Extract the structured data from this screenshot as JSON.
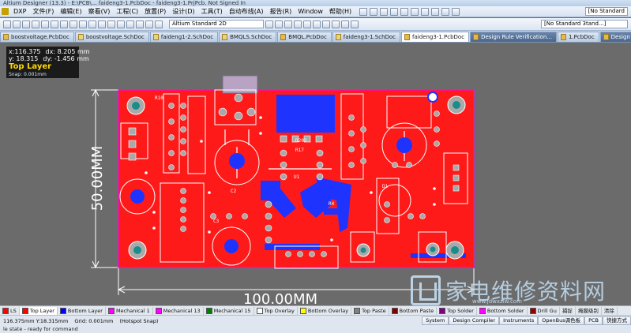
{
  "window": {
    "title": "Altium Designer (13.3) - E:\\PCB\\... faideng3-1.PcbDoc - faideng3-1.PrjPcb. Not Signed In"
  },
  "menu": {
    "items": [
      "DXP",
      "文件(F)",
      "编辑(E)",
      "察看(V)",
      "工程(C)",
      "放置(P)",
      "设计(D)",
      "工具(T)",
      "自动布线(A)",
      "报告(R)",
      "Window",
      "帮助(H)"
    ],
    "view_select": "Altium Standard 2D",
    "right_select": "[No Standard 3tand...]",
    "right_select2": "[No Standard"
  },
  "tabs": [
    {
      "label": "boostvoltage.PcbDoc",
      "kind": "pcb"
    },
    {
      "label": "boostvoltage.SchDoc",
      "kind": "sch"
    },
    {
      "label": "faideng1-2.SchDoc",
      "kind": "sch"
    },
    {
      "label": "BMQLS.SchDoc",
      "kind": "sch"
    },
    {
      "label": "BMQL.PcbDoc",
      "kind": "pcb"
    },
    {
      "label": "faideng3-1.SchDoc",
      "kind": "sch"
    },
    {
      "label": "faideng3-1.PcbDoc",
      "kind": "pcb",
      "active": true
    },
    {
      "label": "Design Rule Verification...",
      "kind": "dark"
    },
    {
      "label": "1.PcbDoc",
      "kind": "pcb"
    },
    {
      "label": "Design Rule Verifica",
      "kind": "dark"
    }
  ],
  "hud": {
    "x": "x:116.375",
    "dx": "dx:  8.205 mm",
    "y": "y: 18.315",
    "dy": "dy: -1.456  mm",
    "layer": "Top Layer",
    "snap": "Snap: 0.001mm"
  },
  "dimensions": {
    "vertical": "50.00MM",
    "horizontal": "100.00MM"
  },
  "pcb_labels": {
    "d202": "D202",
    "r17": "R17",
    "r4": "R4",
    "c2": "C2",
    "c3": "C3",
    "r10": "R10",
    "u1": "U1",
    "d1": "D1"
  },
  "layer_tabs": [
    {
      "label": "LS",
      "color": "#ff0000"
    },
    {
      "label": "Top Layer",
      "color": "#ff0000",
      "active": true
    },
    {
      "label": "Bottom Layer",
      "color": "#0000ff"
    },
    {
      "label": "Mechanical 1",
      "color": "#ff00ff"
    },
    {
      "label": "Mechanical 13",
      "color": "#ff00ff"
    },
    {
      "label": "Mechanical 15",
      "color": "#008000"
    },
    {
      "label": "Top Overlay",
      "color": "#ffffff"
    },
    {
      "label": "Bottom Overlay",
      "color": "#ffff00"
    },
    {
      "label": "Top Paste",
      "color": "#808080"
    },
    {
      "label": "Bottom Paste",
      "color": "#800000"
    },
    {
      "label": "Top Solder",
      "color": "#800080"
    },
    {
      "label": "Bottom Solder",
      "color": "#ff00ff"
    },
    {
      "label": "Drill Gu",
      "color": "#9b0000"
    },
    {
      "label": "捕捉",
      "color": null
    },
    {
      "label": "掩膜级别",
      "color": null
    },
    {
      "label": "清除",
      "color": null
    }
  ],
  "status": {
    "coords": "116.375mm Y:18.315mm",
    "grid": "Grid: 0.001mm",
    "hotspot": "(Hotspot Snap)",
    "line2": "le state - ready for command"
  },
  "status_buttons": [
    "System",
    "Design Compiler",
    "Instruments",
    "OpenBus调色板",
    "PCB",
    "快捷方式"
  ],
  "watermark": {
    "text": "家电维修资料网",
    "url": "www.jdwxzlw.com"
  },
  "colors": {
    "board": "#ff1a1a",
    "workspace": "#6b6b6b",
    "bottom_trace": "#1f33ff",
    "overlay": "#ffffff",
    "pad": "#a9a9a9",
    "via_core": "#1a8c8c"
  }
}
